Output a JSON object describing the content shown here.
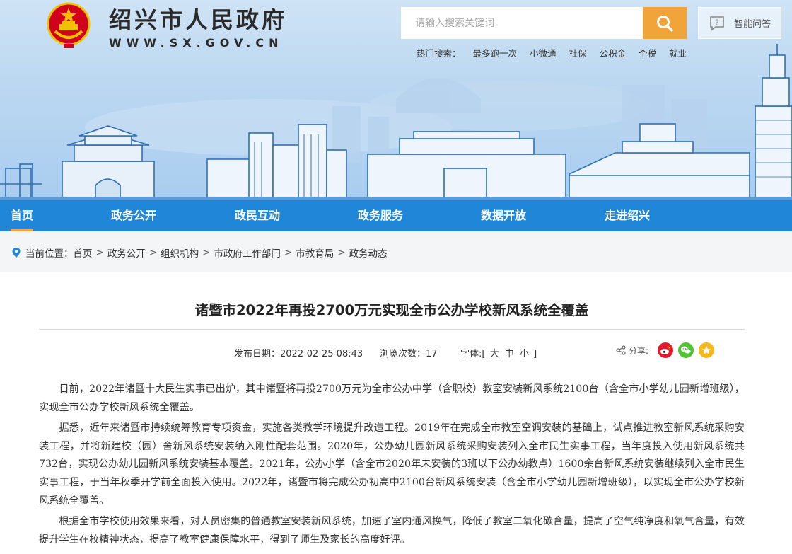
{
  "header": {
    "site_title": "绍兴市人民政府",
    "site_url": "WWW.SX.GOV.CN",
    "search_placeholder": "请输入搜索关键词",
    "qa_label": "智能问答",
    "hot_label": "热门搜索：",
    "hot_items": [
      "最多跑一次",
      "小微通",
      "社保",
      "公积金",
      "个税",
      "就业"
    ]
  },
  "nav": {
    "items": [
      "首页",
      "政务公开",
      "政民互动",
      "政务服务",
      "数据开放",
      "走进绍兴"
    ],
    "active_index": 0
  },
  "breadcrumb": {
    "label": "当前位置：",
    "items": [
      "首页",
      "政务公开",
      "组织机构",
      "市政府工作部门",
      "市教育局",
      "政务动态"
    ],
    "separator": ">"
  },
  "article": {
    "title": "诸暨市2022年再投2700万元实现全市公办学校新风系统全覆盖",
    "publish_date": "发布日期：2022-02-25 08:43",
    "views": "浏览次数：17",
    "font_label": "字体:[",
    "font_sizes": [
      "大",
      "中",
      "小"
    ],
    "font_close": "]",
    "share_label": "分享:",
    "paragraphs": [
      "日前，2022年诸暨十大民生实事已出炉，其中诸暨将再投2700万元为全市公办中学（含职校）教室安装新风系统2100台（含全市小学幼儿园新增班级），实现全市公办学校新风系统全覆盖。",
      "据悉，近年来诸暨市持续统筹教育专项资金，实施各类教学环境提升改造工程。2019年在完成全市教室空调安装的基础上，试点推进教室新风系统采购安装工程，并将新建校（园）舍新风系统安装纳入刚性配套范围。2020年，公办幼儿园新风系统采购安装列入全市民生实事工程，当年度投入使用新风系统共732台，实现公办幼儿园新风系统安装基本覆盖。2021年，公办小学（含全市2020年未安装的3班以下公办幼教点）1600余台新风系统安装继续列入全市民生实事工程，于当年秋季开学前全面投入使用。2022年，诸暨市将完成公办初高中2100台新风系统安装（含全市小学幼儿园新增班级），以实现全市公办学校新风系统全覆盖。",
      "根据全市学校使用效果来看，对人员密集的普通教室安装新风系统，加速了室内通风换气，降低了教室二氧化碳含量，提高了空气纯净度和氧气含量，有效提升学生在校精神状态，提高了教室健康保障水平，得到了师生及家长的高度好评。"
    ]
  },
  "colors": {
    "nav_bg": "#1f86d8",
    "accent": "#f0a43a",
    "weibo": "#e6162d",
    "wechat": "#51c332",
    "qzone": "#f5b81a"
  }
}
